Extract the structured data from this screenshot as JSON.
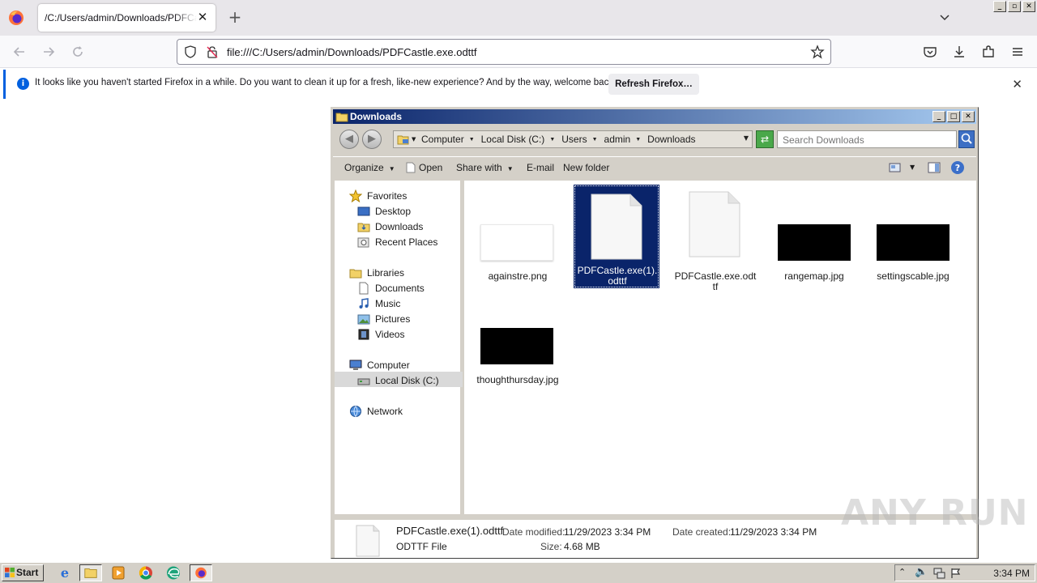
{
  "browser": {
    "tab_title": "/C:/Users/admin/Downloads/PDFCastle.exe.odttf",
    "url": "file:///C:/Users/admin/Downloads/PDFCastle.exe.odttf",
    "notification": {
      "text": "It looks like you haven't started Firefox in a while. Do you want to clean it up for a fresh, like-new experience? And by the way, welcome back!",
      "button_label": "Refresh Firefox…"
    }
  },
  "explorer": {
    "title": "Downloads",
    "breadcrumb": [
      "Computer",
      "Local Disk (C:)",
      "Users",
      "admin",
      "Downloads"
    ],
    "search_placeholder": "Search Downloads",
    "toolbar": {
      "organize": "Organize",
      "open": "Open",
      "share_with": "Share with",
      "email": "E-mail",
      "new_folder": "New folder"
    },
    "nav": {
      "favorites": "Favorites",
      "desktop": "Desktop",
      "downloads": "Downloads",
      "recent_places": "Recent Places",
      "libraries": "Libraries",
      "documents": "Documents",
      "music": "Music",
      "pictures": "Pictures",
      "videos": "Videos",
      "computer": "Computer",
      "local_disk": "Local Disk (C:)",
      "network": "Network"
    },
    "files": [
      {
        "name": "againstre.png",
        "kind": "white-image"
      },
      {
        "name": "PDFCastle.exe(1).odttf",
        "kind": "document",
        "selected": true
      },
      {
        "name": "PDFCastle.exe.odttf",
        "kind": "document"
      },
      {
        "name": "rangemap.jpg",
        "kind": "black-image"
      },
      {
        "name": "settingscable.jpg",
        "kind": "black-image"
      },
      {
        "name": "thoughthursday.jpg",
        "kind": "black-image"
      }
    ],
    "details": {
      "name": "PDFCastle.exe(1).odttf",
      "type": "ODTTF File",
      "date_modified_label": "Date modified:",
      "date_modified": "11/29/2023 3:34 PM",
      "size_label": "Size:",
      "size": "4.68 MB",
      "date_created_label": "Date created:",
      "date_created": "11/29/2023 3:34 PM"
    }
  },
  "taskbar": {
    "start_label": "Start",
    "clock": "3:34 PM"
  },
  "watermark": "ANY RUN",
  "colors": {
    "title_gradient_start": "#0a246a",
    "selection": "#0a246a",
    "classic_gray": "#d4d0c8",
    "firefox_accent": "#0060df"
  }
}
